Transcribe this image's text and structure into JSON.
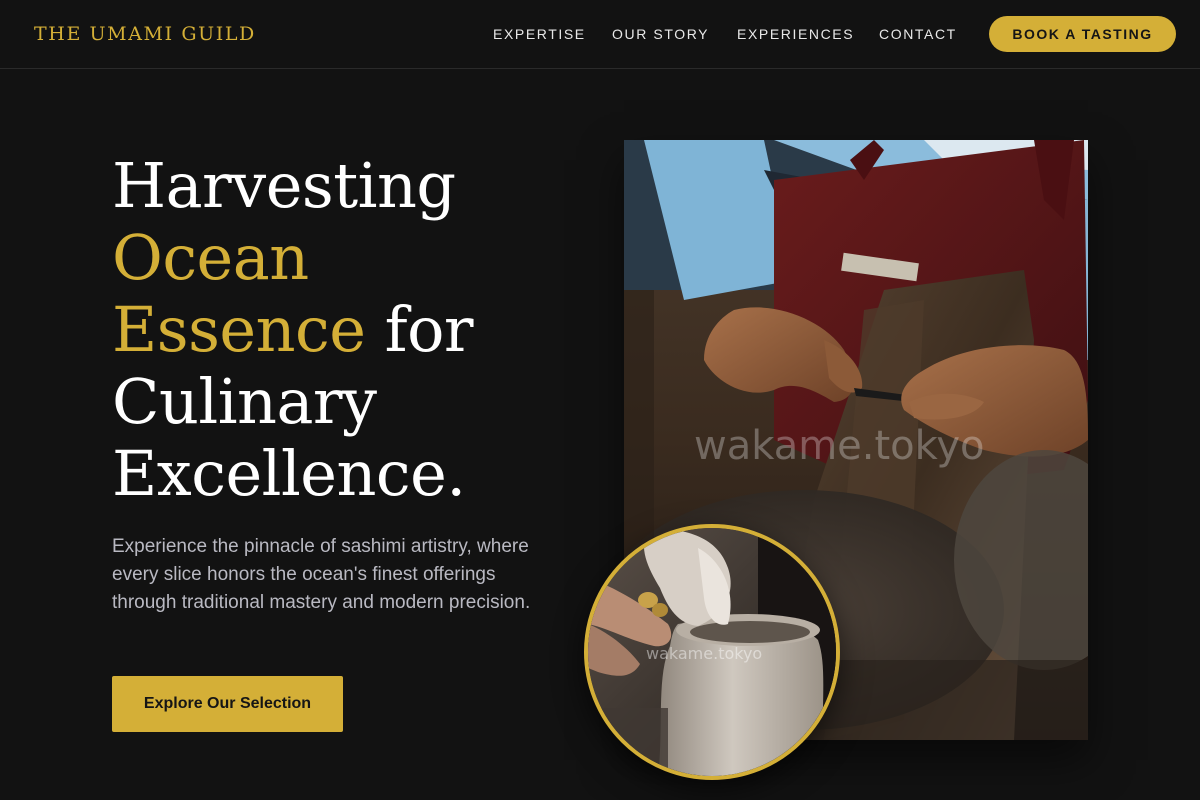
{
  "brand": {
    "name": "THE UMAMI GUILD"
  },
  "nav": {
    "items": [
      {
        "label": "EXPERTISE"
      },
      {
        "label": "OUR STORY"
      },
      {
        "label": "EXPERIENCES"
      },
      {
        "label": "CONTACT"
      }
    ],
    "cta_label": "BOOK A TASTING"
  },
  "hero": {
    "title": {
      "line1": "Harvesting",
      "line2_gold": "Ocean",
      "line3_gold": "Essence",
      "line3_rest": " for",
      "line4": "Culinary",
      "line5": "Excellence."
    },
    "description": "Experience the pinnacle of sashimi artistry, where every slice honors the ocean's finest offerings through traditional mastery and modern precision.",
    "cta_label": "Explore Our Selection"
  },
  "images": {
    "main": {
      "watermark": "wakame.tokyo",
      "subject": "artisan-hands-carving"
    },
    "circle": {
      "watermark": "wakame.tokyo",
      "subject": "hands-shaping-pottery"
    }
  },
  "colors": {
    "background": "#121212",
    "accent_gold": "#d4af37",
    "text_primary": "#ffffff",
    "text_muted": "#b9b9c2"
  }
}
